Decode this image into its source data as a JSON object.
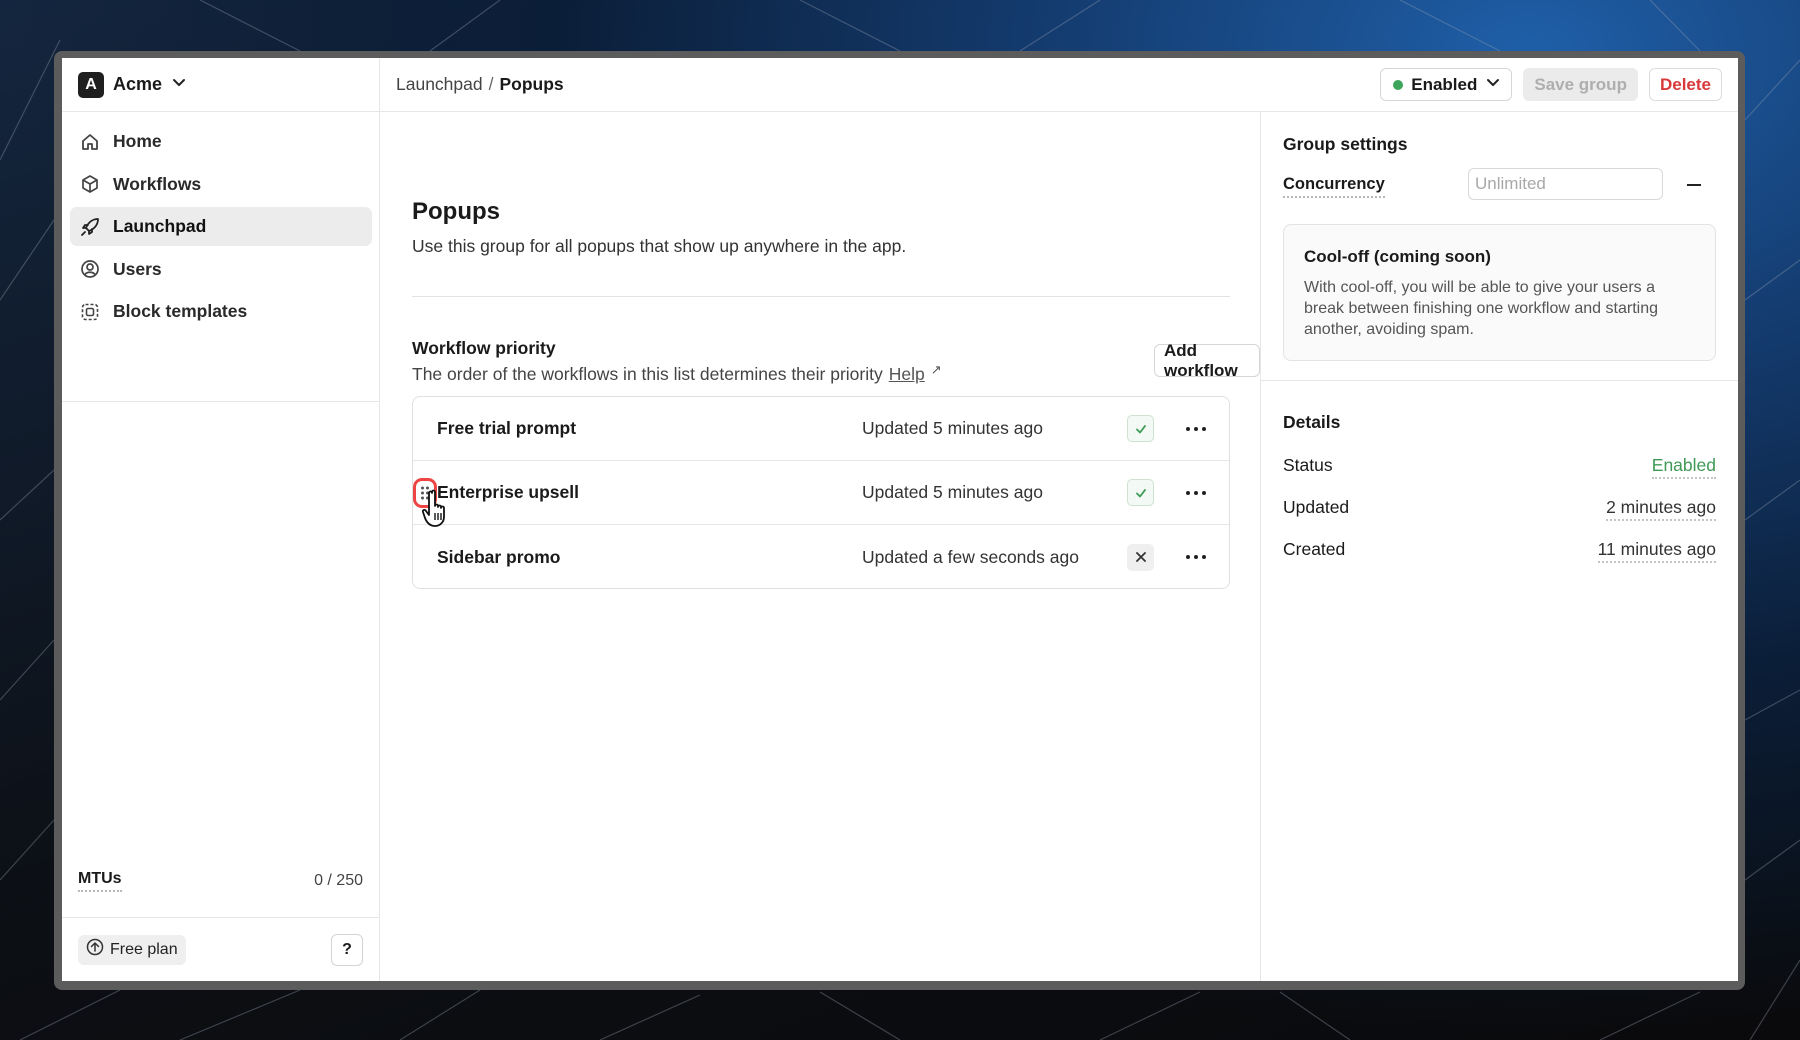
{
  "org": {
    "initial": "A",
    "name": "Acme"
  },
  "sidebar": {
    "items": [
      {
        "label": "Home",
        "icon": "home-icon",
        "active": false
      },
      {
        "label": "Workflows",
        "icon": "cube-icon",
        "active": false
      },
      {
        "label": "Launchpad",
        "icon": "rocket-icon",
        "active": true
      },
      {
        "label": "Users",
        "icon": "user-circle-icon",
        "active": false
      },
      {
        "label": "Block templates",
        "icon": "block-template-icon",
        "active": false
      }
    ],
    "mtus_label": "MTUs",
    "mtus_value": "0 / 250",
    "plan_label": "Free plan",
    "help_label": "?"
  },
  "breadcrumb": {
    "parent": "Launchpad",
    "separator": "/",
    "current": "Popups"
  },
  "toolbar": {
    "status_label": "Enabled",
    "status_color": "#3ea65a",
    "save_label": "Save group",
    "delete_label": "Delete"
  },
  "main": {
    "title": "Popups",
    "description": "Use this group for all popups that show up anywhere in the app.",
    "priority_title": "Workflow priority",
    "priority_desc": "The order of the workflows in this list determines their priority",
    "help_link": "Help",
    "add_label": "Add workflow",
    "workflows": [
      {
        "name": "Free trial prompt",
        "updated": "Updated 5 minutes ago",
        "enabled": true
      },
      {
        "name": "Enterprise upsell",
        "updated": "Updated 5 minutes ago",
        "enabled": true
      },
      {
        "name": "Sidebar promo",
        "updated": "Updated a few seconds ago",
        "enabled": false
      }
    ]
  },
  "panel": {
    "group_settings_title": "Group settings",
    "concurrency_label": "Concurrency",
    "concurrency_placeholder": "Unlimited",
    "cooloff_title": "Cool-off (coming soon)",
    "cooloff_body": "With cool-off, you will be able to give your users a break between finishing one workflow and starting another, avoiding spam.",
    "details_title": "Details",
    "details": [
      {
        "label": "Status",
        "value": "Enabled"
      },
      {
        "label": "Updated",
        "value": "2 minutes ago"
      },
      {
        "label": "Created",
        "value": "11 minutes ago"
      }
    ]
  },
  "colors": {
    "enabled_green": "#3ea65a",
    "delete_red": "#d83a3a",
    "highlight_red": "#ee4444"
  }
}
